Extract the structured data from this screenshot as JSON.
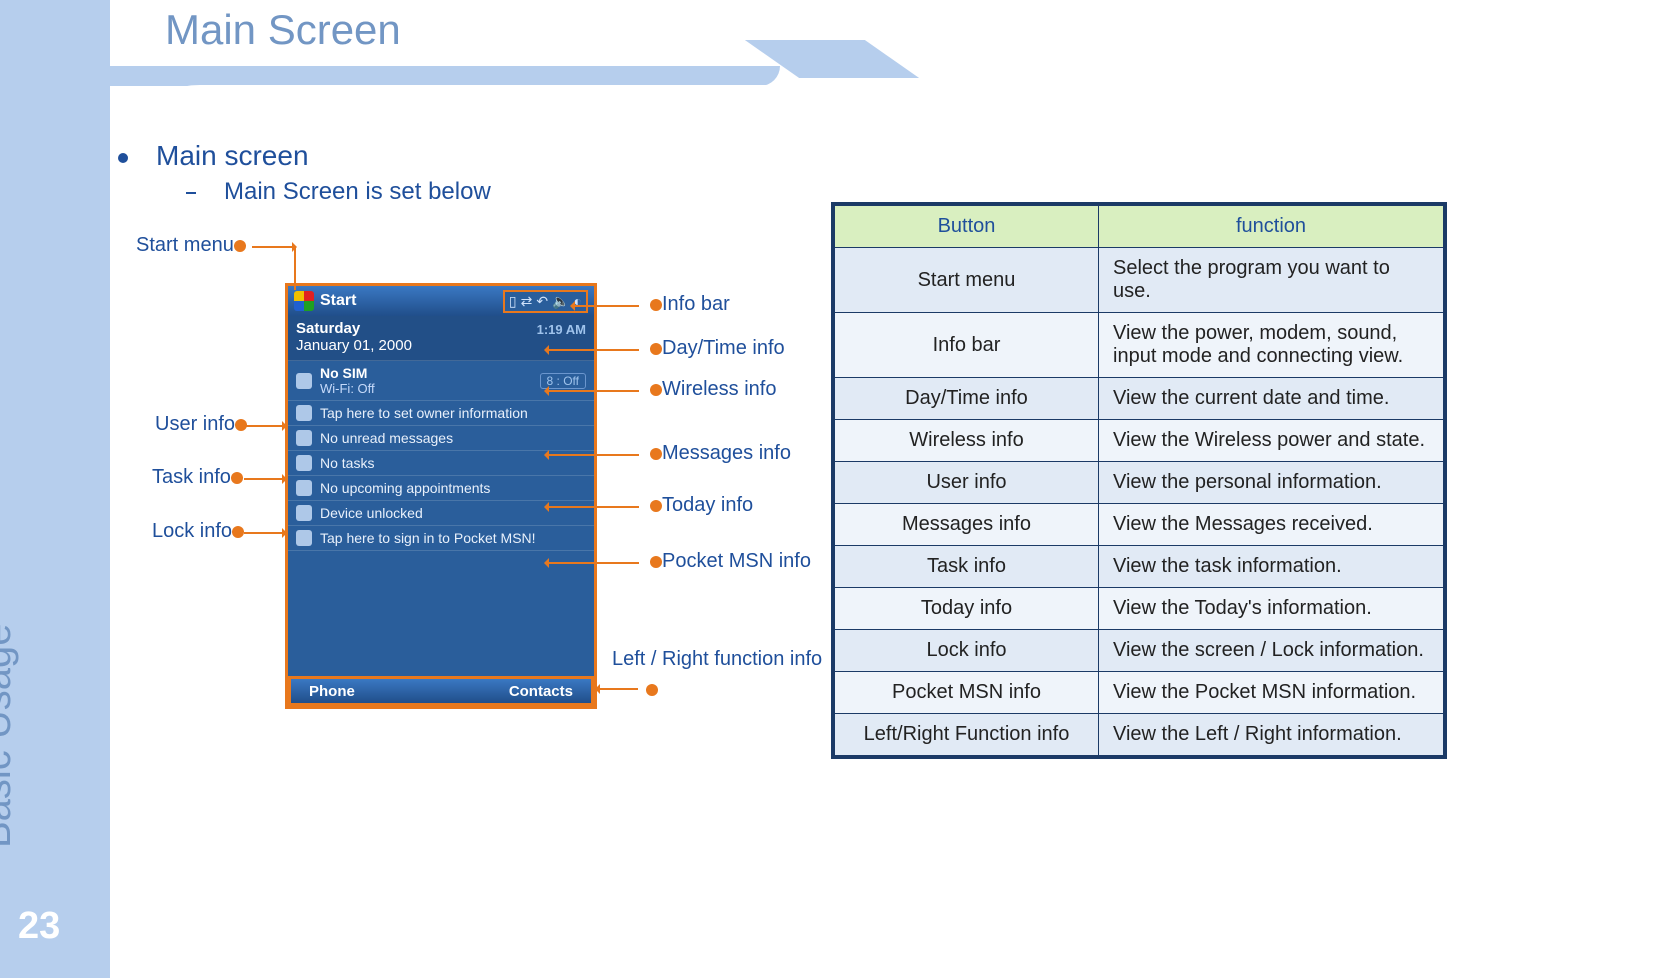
{
  "page": {
    "title": "Main Screen",
    "section": "Basic Usage",
    "number": "23"
  },
  "bullet1": "Main screen",
  "bullet2": "Main Screen is set below",
  "annotations": {
    "start_menu": "Start menu",
    "info_bar": "Info bar",
    "daytime": "Day/Time info",
    "wireless": "Wireless info",
    "user": "User info",
    "task": "Task info",
    "lock": "Lock info",
    "messages": "Messages info",
    "today": "Today info",
    "pocketmsn": "Pocket MSN info",
    "footer": "Left / Right function info"
  },
  "phone": {
    "start": "Start",
    "day": "Saturday",
    "date": "January 01, 2000",
    "time": "1:19 AM",
    "sim": "No SIM",
    "wifi": "Wi-Fi: Off",
    "battery": "8 : Off",
    "owner": "Tap here to set owner information",
    "msg": "No unread messages",
    "task": "No tasks",
    "appt": "No upcoming appointments",
    "lock": "Device unlocked",
    "msn": "Tap here to sign in to Pocket MSN!",
    "left": "Phone",
    "right": "Contacts"
  },
  "table": {
    "head_button": "Button",
    "head_function": "function",
    "rows": [
      {
        "b": "Start menu",
        "f": "Select the program you want to use."
      },
      {
        "b": "Info bar",
        "f": "View the power, modem, sound, input mode and connecting view."
      },
      {
        "b": "Day/Time info",
        "f": "View the current date and time."
      },
      {
        "b": "Wireless info",
        "f": "View the Wireless power and state."
      },
      {
        "b": "User info",
        "f": "View the personal information."
      },
      {
        "b": "Messages info",
        "f": "View the Messages received."
      },
      {
        "b": "Task info",
        "f": "View the task information."
      },
      {
        "b": "Today info",
        "f": "View the Today's information."
      },
      {
        "b": "Lock info",
        "f": "View the screen / Lock information."
      },
      {
        "b": "Pocket MSN info",
        "f": "View the Pocket MSN information."
      },
      {
        "b": "Left/Right Function info",
        "f": "View the Left / Right information."
      }
    ]
  }
}
